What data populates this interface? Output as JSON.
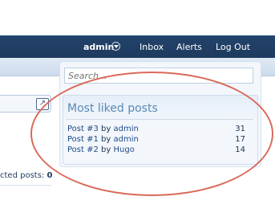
{
  "nav": {
    "user": "admin",
    "inbox": "Inbox",
    "alerts": "Alerts",
    "logout": "Log Out"
  },
  "search": {
    "placeholder": "Search..."
  },
  "left": {
    "text_prefix": "cted posts: ",
    "text_value": "0"
  },
  "widget": {
    "title": "Most liked posts",
    "posts": [
      {
        "post": "Post #3",
        "by": "by",
        "author": "admin",
        "likes": "31"
      },
      {
        "post": "Post #1",
        "by": "by",
        "author": "admin",
        "likes": "17"
      },
      {
        "post": "Post #2",
        "by": "by",
        "author": "Hugo",
        "likes": "14"
      }
    ]
  },
  "colors": {
    "header": "#23436b",
    "accent_title": "#5a89b5",
    "highlight_ellipse": "#d96a5a"
  },
  "icons": [
    "chevron-down-icon",
    "external-link-icon"
  ]
}
